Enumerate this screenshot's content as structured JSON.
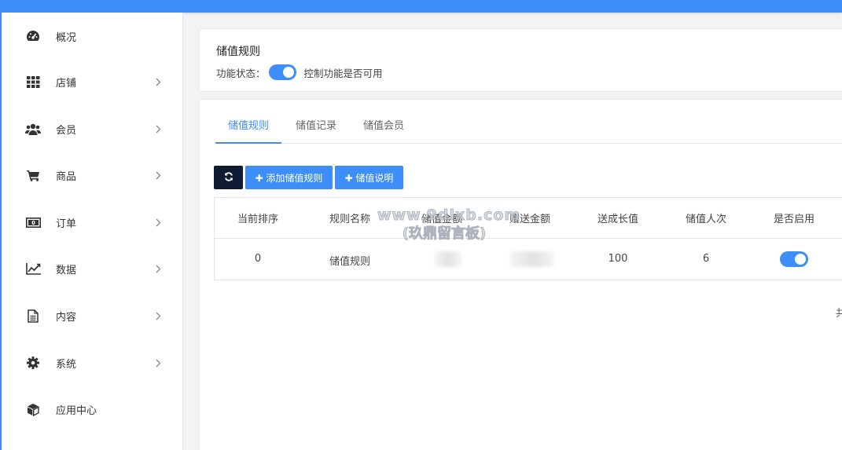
{
  "sidebar": {
    "items": [
      {
        "label": "概况",
        "icon": "dashboard-icon",
        "has_children": false
      },
      {
        "label": "店铺",
        "icon": "grid-icon",
        "has_children": true
      },
      {
        "label": "会员",
        "icon": "users-icon",
        "has_children": true
      },
      {
        "label": "商品",
        "icon": "cart-icon",
        "has_children": true
      },
      {
        "label": "订单",
        "icon": "money-icon",
        "has_children": true
      },
      {
        "label": "数据",
        "icon": "line-chart-icon",
        "has_children": true
      },
      {
        "label": "内容",
        "icon": "document-icon",
        "has_children": true
      },
      {
        "label": "系统",
        "icon": "gear-icon",
        "has_children": true
      },
      {
        "label": "应用中心",
        "icon": "cube-icon",
        "has_children": false
      }
    ]
  },
  "settings_card": {
    "title": "储值规则",
    "status_label": "功能状态：",
    "status_enabled": true,
    "status_hint": "控制功能是否可用"
  },
  "tabs": [
    {
      "label": "储值规则",
      "active": true
    },
    {
      "label": "储值记录",
      "active": false
    },
    {
      "label": "储值会员",
      "active": false
    }
  ],
  "toolbar": {
    "refresh_icon": "refresh-icon",
    "add_label": "✚ 添加储值规则",
    "explain_label": "✚ 储值说明"
  },
  "table": {
    "columns": [
      "当前排序",
      "规则名称",
      "储值金额",
      "赠送金额",
      "送成长值",
      "储值人次",
      "是否启用"
    ],
    "rows": [
      {
        "sort": "0",
        "name": "储值规则",
        "amount": "",
        "bonus": "",
        "growth": "100",
        "count": "6",
        "enabled": true
      }
    ]
  },
  "watermark": {
    "line1": "www.9dlxb.com",
    "line2": "(玖鼎留言板)"
  },
  "pagination_fragment": "共",
  "colors": {
    "accent": "#3d8ef8",
    "dark_button": "#0e1b32"
  }
}
